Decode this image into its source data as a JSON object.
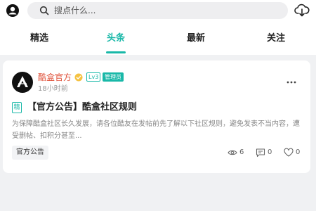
{
  "header": {
    "search_placeholder": "搜点什么..."
  },
  "tabs": [
    {
      "label": "精选"
    },
    {
      "label": "头条"
    },
    {
      "label": "最新"
    },
    {
      "label": "关注"
    }
  ],
  "post": {
    "author": "酷盒官方",
    "level": "Lv3",
    "role": "管理员",
    "time": "18小时前",
    "essence_badge": "精",
    "title": "【官方公告】酷盒社区规则",
    "excerpt": "为保障酷盒社区长久发展，请各位酷友在发帖前先了解以下社区规则，避免发表不当内容，遭受删帖、扣积分甚至...",
    "tag": "官方公告",
    "views": "6",
    "comments": "0",
    "likes": "0"
  },
  "colors": {
    "accent": "#19b8a8",
    "author": "#e0533c",
    "background": "#f0f1f3"
  },
  "icons": [
    "user-icon",
    "search-icon",
    "cloud-download-icon",
    "verified-icon",
    "more-icon",
    "eye-icon",
    "comment-icon",
    "heart-icon"
  ]
}
